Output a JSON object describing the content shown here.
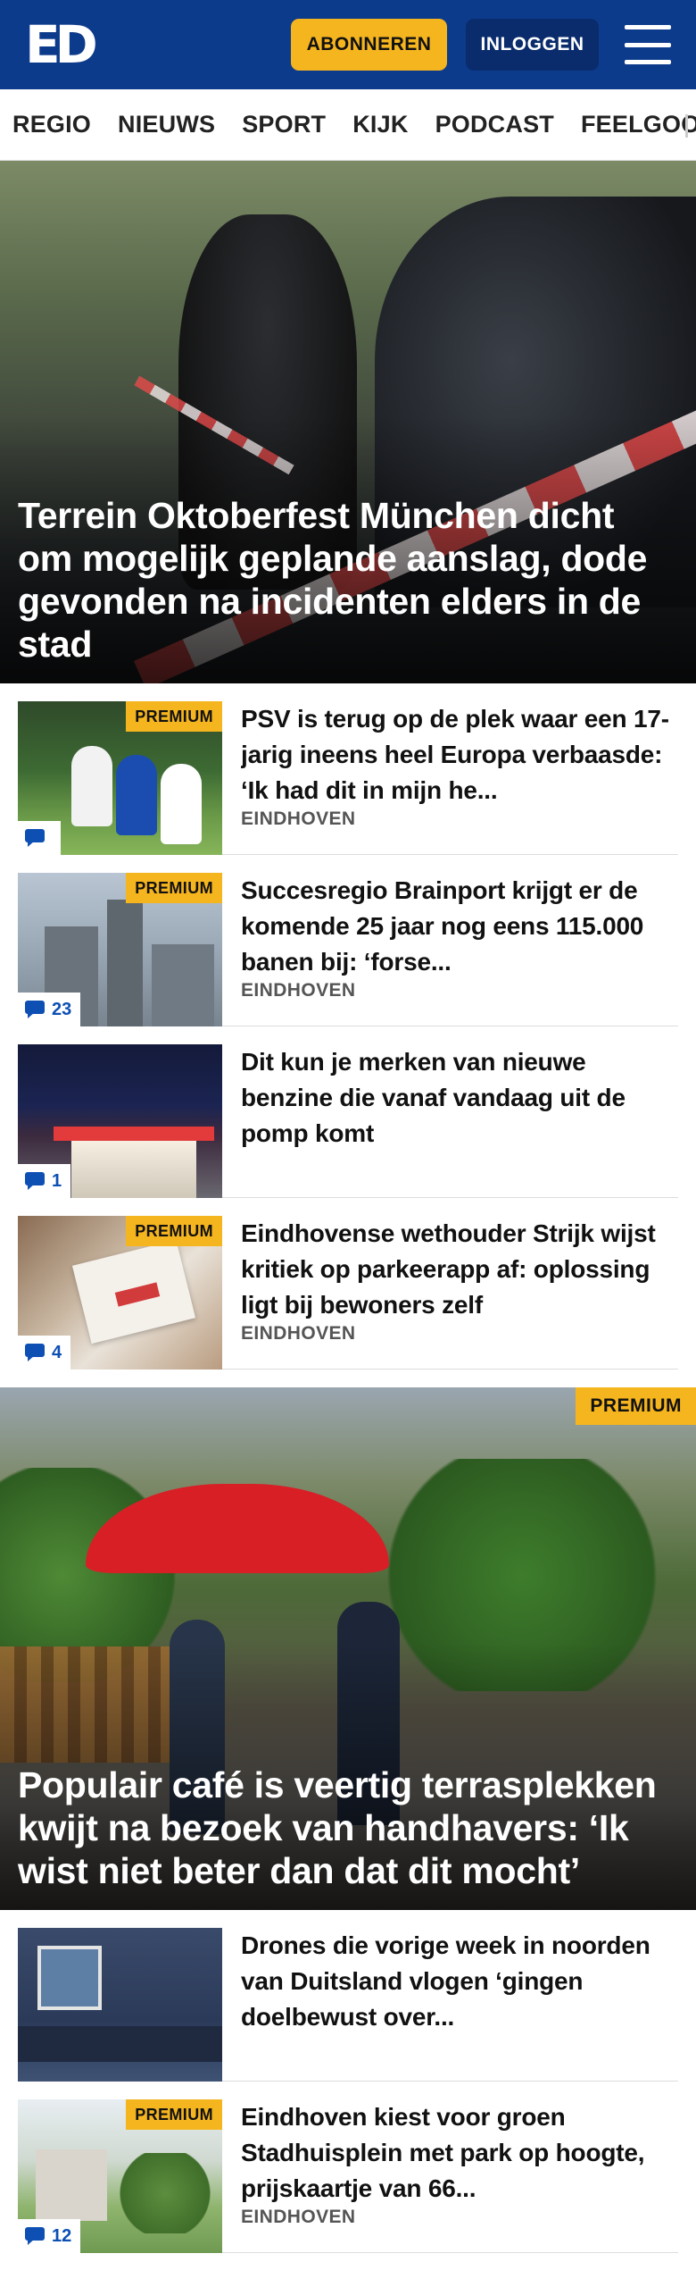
{
  "header": {
    "logo": "ED",
    "subscribe_label": "ABONNEREN",
    "login_label": "INLOGGEN",
    "menu_icon": "hamburger-menu-icon"
  },
  "nav": {
    "items": [
      "REGIO",
      "NIEUWS",
      "SPORT",
      "KIJK",
      "PODCAST",
      "FEELGOOD"
    ]
  },
  "hero1": {
    "title": "Terrein Oktoberfest München dicht om mogelijk geplande aanslag, dode gevonden na incidenten elders in de stad"
  },
  "articles1": [
    {
      "premium": "PREMIUM",
      "comments": "",
      "title": "PSV is terug op de plek waar een 17-jarig ineens heel Europa verbaasde: ‘Ik had dit in mijn he...",
      "location": "EINDHOVEN"
    },
    {
      "premium": "PREMIUM",
      "comments": "23",
      "title": "Succesregio Brainport krijgt er de komende 25 jaar nog eens 115.000 banen bij: ‘forse...",
      "location": "EINDHOVEN"
    },
    {
      "premium": "",
      "comments": "1",
      "title": "Dit kun je merken van nieuwe benzine die vanaf vandaag uit de pomp komt",
      "location": ""
    },
    {
      "premium": "PREMIUM",
      "comments": "4",
      "title": "Eindhovense wethouder Strijk wijst kritiek op parkeerapp af: oplossing ligt bij bewoners zelf",
      "location": "EINDHOVEN"
    }
  ],
  "hero2": {
    "premium": "PREMIUM",
    "title": "Populair café is veertig terrasplekken kwijt na bezoek van handhavers: ‘Ik wist niet beter dan dat dit mocht’"
  },
  "articles2": [
    {
      "premium": "",
      "comments": "",
      "title": "Drones die vorige week in noorden van Duitsland vlogen ‘gingen doelbewust over...",
      "location": ""
    },
    {
      "premium": "PREMIUM",
      "comments": "12",
      "title": "Eindhoven kiest voor groen Stadhuisplein met park op hoogte, prijskaartje van 66...",
      "location": "EINDHOVEN"
    }
  ],
  "colors": {
    "brand_blue": "#0d3b8c",
    "premium_yellow": "#f5b51e",
    "comment_blue": "#0d4fb3"
  }
}
